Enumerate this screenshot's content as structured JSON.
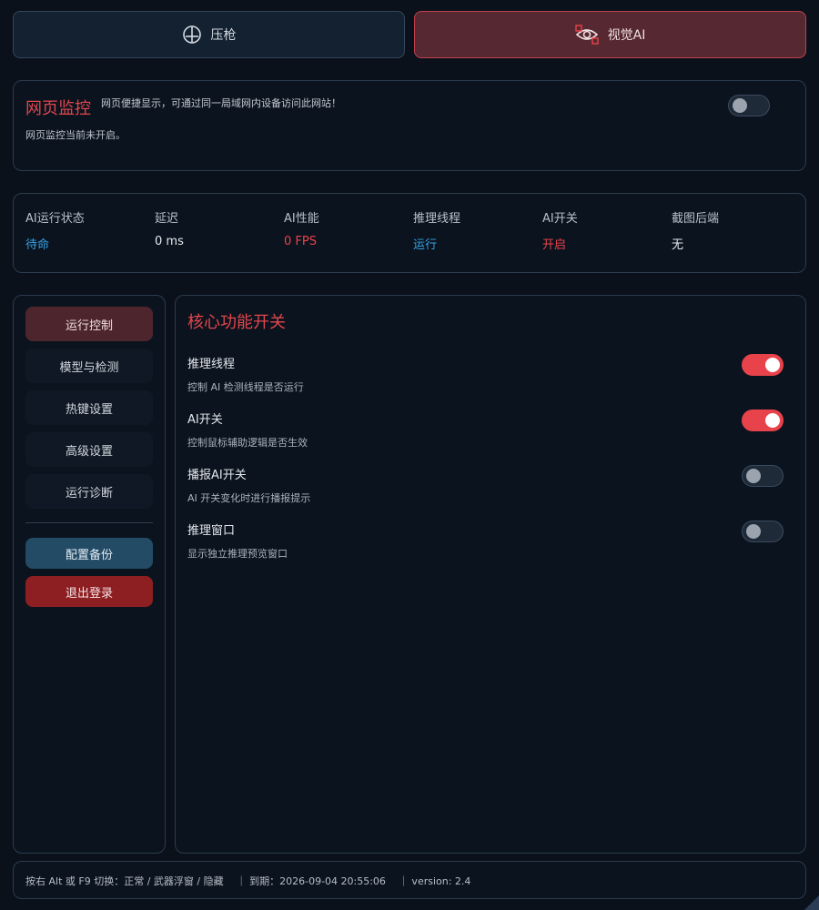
{
  "tabs": [
    {
      "label": "压枪",
      "icon": "crosshair-icon"
    },
    {
      "label": "视觉AI",
      "icon": "eye-target-icon"
    }
  ],
  "web_monitor": {
    "title": "网页监控",
    "description": "网页便捷显示，可通过同一局域网内设备访问此网站！",
    "status": "网页监控当前未开启。",
    "enabled": false
  },
  "status_strip": [
    {
      "label": "AI运行状态",
      "value": "待命",
      "color": "#37a3e6"
    },
    {
      "label": "延迟",
      "value": "0 ms",
      "color": "#e6eaef"
    },
    {
      "label": "AI性能",
      "value": "0 FPS",
      "color": "#e8434a"
    },
    {
      "label": "推理线程",
      "value": "运行",
      "color": "#37a3e6"
    },
    {
      "label": "AI开关",
      "value": "开启",
      "color": "#e8434a"
    },
    {
      "label": "截图后端",
      "value": "无",
      "color": "#e6eaef"
    }
  ],
  "sidebar": {
    "items": [
      {
        "label": "运行控制",
        "active": true
      },
      {
        "label": "模型与检测",
        "active": false
      },
      {
        "label": "热键设置",
        "active": false
      },
      {
        "label": "高级设置",
        "active": false
      },
      {
        "label": "运行诊断",
        "active": false
      }
    ],
    "backup_label": "配置备份",
    "logout_label": "退出登录"
  },
  "main": {
    "title": "核心功能开关",
    "options": [
      {
        "title": "推理线程",
        "description": "控制 AI 检测线程是否运行",
        "enabled": true
      },
      {
        "title": "AI开关",
        "description": "控制鼠标辅助逻辑是否生效",
        "enabled": true
      },
      {
        "title": "播报AI开关",
        "description": "AI 开关变化时进行播报提示",
        "enabled": false
      },
      {
        "title": "推理窗口",
        "description": "显示独立推理预览窗口",
        "enabled": false
      }
    ]
  },
  "footer": {
    "hint": "按右 Alt 或 F9 切换：正常 / 武器浮窗 / 隐藏",
    "expiry": "｜ 到期：2026-09-04 20:55:06",
    "version": "｜ version: 2.4"
  },
  "colors": {
    "accent_red": "#e8434a",
    "accent_blue": "#37a3e6",
    "background": "#0a111b"
  }
}
